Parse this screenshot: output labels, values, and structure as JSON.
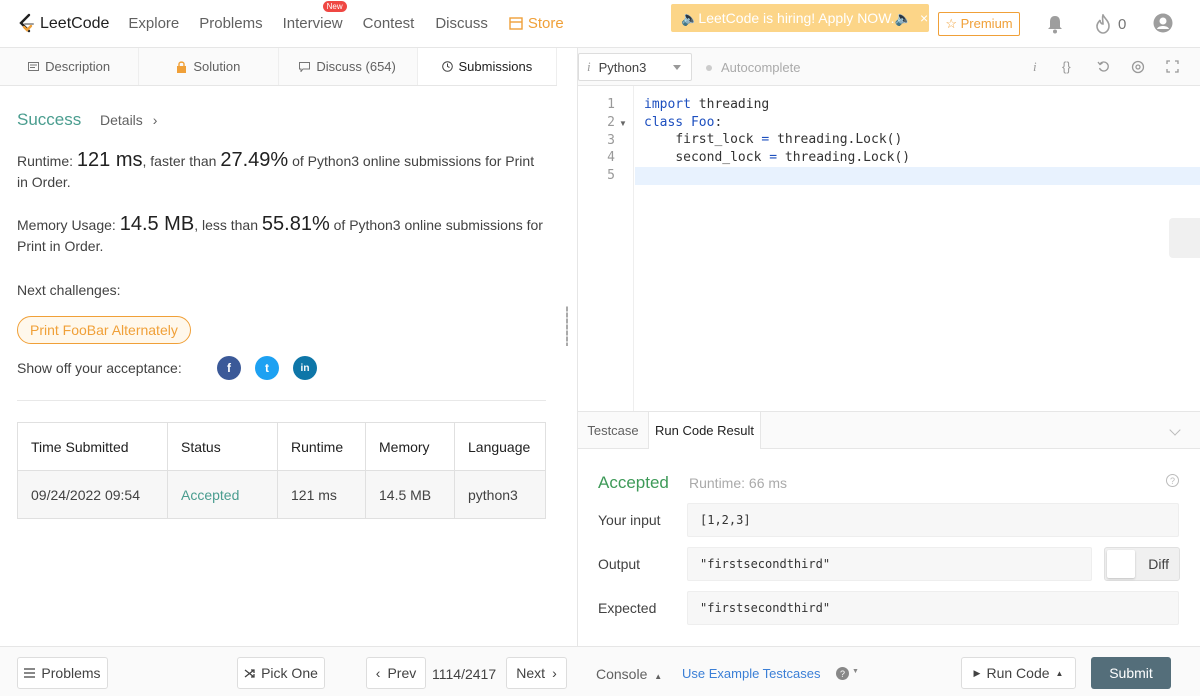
{
  "nav": {
    "logo_text": "LeetCode",
    "links": [
      "Explore",
      "Problems",
      "Interview",
      "Contest",
      "Discuss"
    ],
    "new_badge": "New",
    "store": "Store",
    "hiring_banner": "🔈LeetCode is hiring! Apply NOW.🔈",
    "hiring_close": "×",
    "premium": "☆ Premium",
    "streak_count": "0"
  },
  "left_tabs": [
    "Description",
    "Solution",
    "Discuss (654)",
    "Submissions"
  ],
  "submission": {
    "status": "Success",
    "details": "Details",
    "runtime_label": "Runtime: ",
    "runtime_value": "121 ms",
    "runtime_mid": ", faster than ",
    "runtime_pct": "27.49%",
    "runtime_tail": " of Python3 online submissions for Print in Order.",
    "memory_label": "Memory Usage: ",
    "memory_value": "14.5 MB",
    "memory_mid": ", less than ",
    "memory_pct": "55.81%",
    "memory_tail": " of Python3 online submissions for Print in Order.",
    "next_challenges": "Next challenges:",
    "next_pill": "Print FooBar Alternately",
    "show_off": "Show off your acceptance:",
    "social": [
      "f",
      "t",
      "in"
    ]
  },
  "table": {
    "headers": [
      "Time Submitted",
      "Status",
      "Runtime",
      "Memory",
      "Language"
    ],
    "row": [
      "09/24/2022 09:54",
      "Accepted",
      "121 ms",
      "14.5 MB",
      "python3"
    ]
  },
  "editor": {
    "language": "Python3",
    "lang_icon": "i",
    "autocomplete": "Autocomplete",
    "line_numbers": [
      "1",
      "2",
      "3",
      "4",
      "5"
    ],
    "lines": [
      {
        "kw": "import",
        "rest": " threading"
      },
      {
        "kw": "class",
        "cls": " Foo",
        "rest": ":"
      },
      {
        "indent": "    ",
        "a": "first_lock",
        "eq": " = ",
        "b": "threading.Lock()"
      },
      {
        "indent": "    ",
        "a": "second_lock",
        "eq": " = ",
        "b": "threading.Lock()"
      },
      {}
    ]
  },
  "result": {
    "tabs": [
      "Testcase",
      "Run Code Result"
    ],
    "status": "Accepted",
    "runtime": "Runtime: 66 ms",
    "your_input_label": "Your input",
    "your_input": "[1,2,3]",
    "output_label": "Output",
    "output": "\"firstsecondthird\"",
    "expected_label": "Expected",
    "expected": "\"firstsecondthird\"",
    "diff": "Diff"
  },
  "bottom": {
    "problems": "Problems",
    "pick_one": "Pick One",
    "prev": "Prev",
    "page": "1114/2417",
    "next": "Next",
    "console": "Console",
    "use_example": "Use Example Testcases",
    "run_code": "Run Code",
    "submit": "Submit"
  },
  "colors": {
    "success": "#4a9d8f",
    "accepted": "#3e9a58",
    "store": "#f0a038",
    "submit_bg": "#546e7a",
    "facebook": "#3b5998",
    "twitter": "#1da1f2",
    "linkedin": "#0e76a8"
  }
}
